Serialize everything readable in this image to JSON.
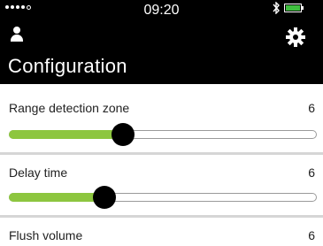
{
  "status_bar": {
    "time": "09:20",
    "bluetooth_icon": "bluetooth-icon",
    "battery_icon": "battery-icon"
  },
  "header": {
    "title": "Configuration",
    "user_icon": "user-icon",
    "settings_icon": "gear-icon"
  },
  "settings": [
    {
      "label": "Range detection zone",
      "value": "6",
      "fraction": 0.33
    },
    {
      "label": "Delay time",
      "value": "6",
      "fraction": 0.27
    },
    {
      "label": "Flush volume",
      "value": "6"
    }
  ],
  "colors": {
    "accent": "#8dc63f",
    "header_bg": "#000000",
    "battery": "#3fbf3f"
  }
}
